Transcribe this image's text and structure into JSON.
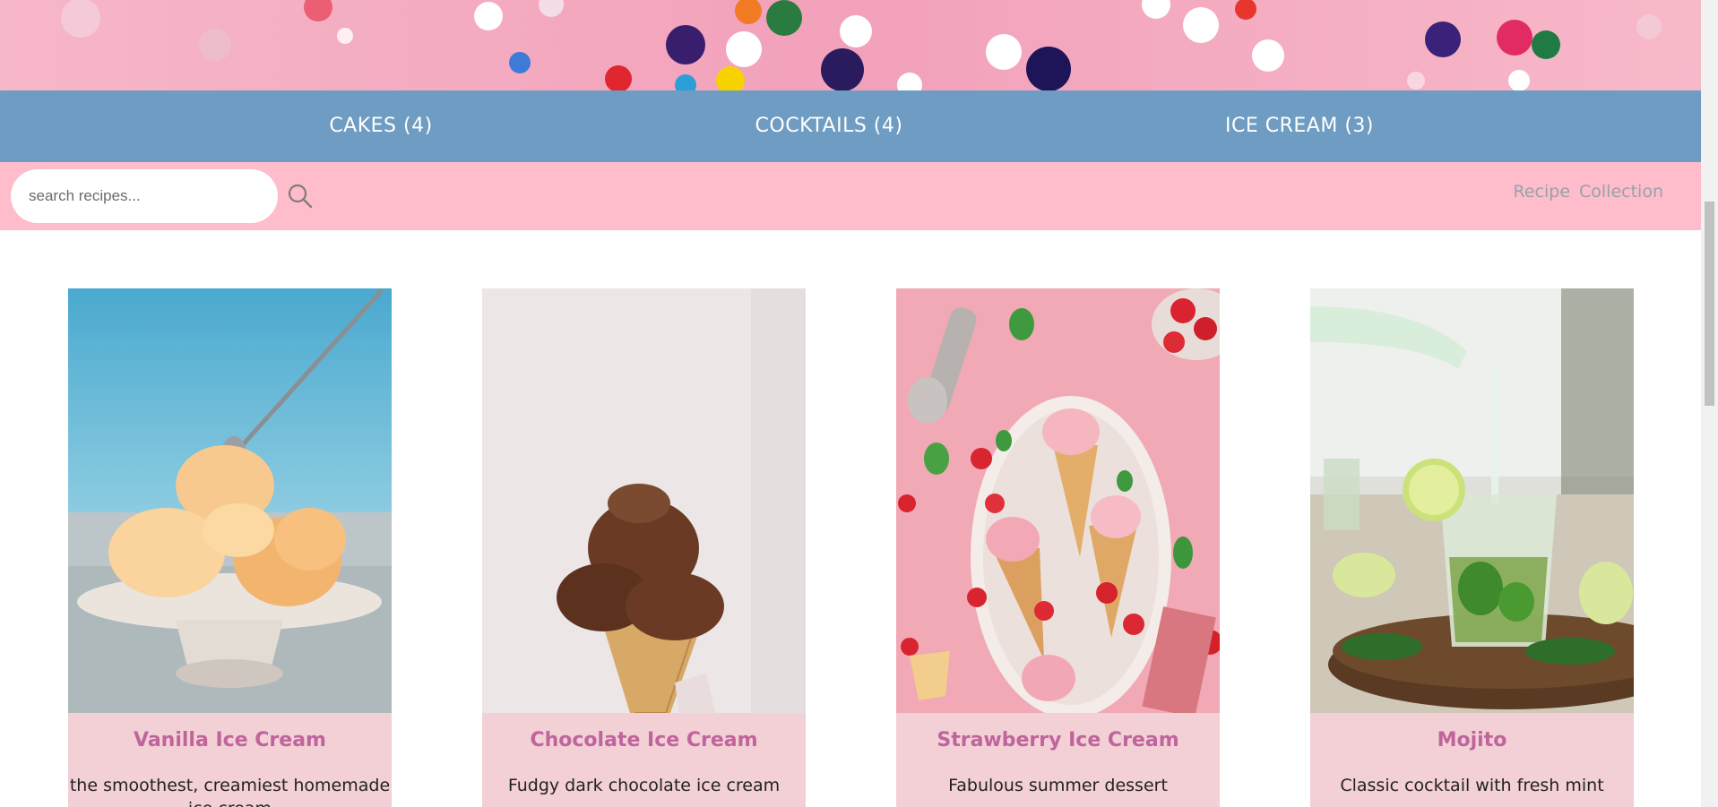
{
  "hero": {
    "image": "sprinkles-banner"
  },
  "nav": {
    "categories": [
      {
        "label": "CAKES (4)"
      },
      {
        "label": "COCKTAILS (4)"
      },
      {
        "label": "ICE CREAM (3)"
      }
    ]
  },
  "search": {
    "placeholder": "search recipes...",
    "value": "",
    "icon": "search-icon"
  },
  "brand": {
    "word1": "Recipe",
    "word2": "Collection"
  },
  "cards": [
    {
      "title": "Vanilla Ice Cream",
      "description": "the smoothest, creamiest homemade ice cream",
      "image": "vanilla-ice-cream-photo"
    },
    {
      "title": "Chocolate Ice Cream",
      "description": "Fudgy dark chocolate ice cream",
      "image": "chocolate-ice-cream-photo"
    },
    {
      "title": "Strawberry Ice Cream",
      "description": "Fabulous summer dessert",
      "image": "strawberry-ice-cream-photo"
    },
    {
      "title": "Mojito",
      "description": "Classic cocktail with fresh mint",
      "image": "mojito-photo"
    }
  ],
  "colors": {
    "nav_bg": "#6f9cc2",
    "search_bar_bg": "#ffbccb",
    "card_bg": "#f3cfd6",
    "title_color": "#c0649c"
  }
}
